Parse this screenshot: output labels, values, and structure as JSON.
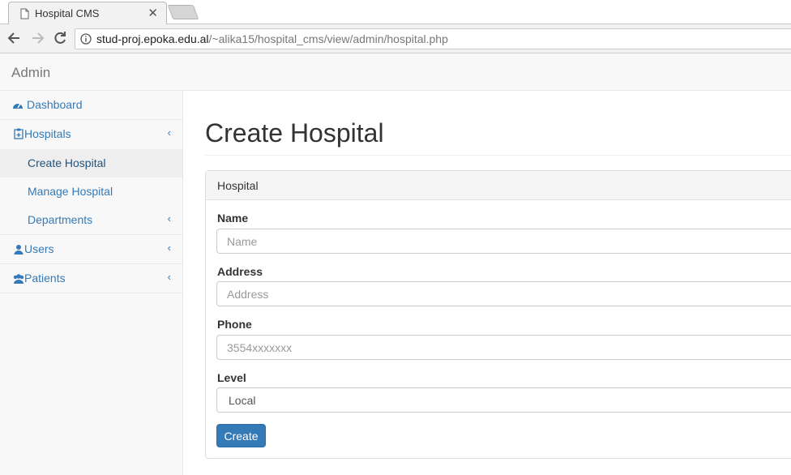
{
  "browser": {
    "tab_title": "Hospital CMS",
    "url_host": "stud-proj.epoka.edu.al",
    "url_path": "/~alika15/hospital_cms/view/admin/hospital.php"
  },
  "navbar": {
    "brand": "Admin"
  },
  "sidebar": {
    "items": [
      {
        "label": "Dashboard",
        "icon": "dashboard-icon"
      },
      {
        "label": "Hospitals",
        "icon": "hospital-icon",
        "arrow": "‹"
      },
      {
        "label": "Users",
        "icon": "user-icon",
        "arrow": "‹"
      },
      {
        "label": "Patients",
        "icon": "users-icon",
        "arrow": "‹"
      }
    ],
    "hospital_subitems": [
      {
        "label": "Create Hospital",
        "active": true
      },
      {
        "label": "Manage Hospital"
      },
      {
        "label": "Departments",
        "arrow": "‹"
      }
    ]
  },
  "main": {
    "title": "Create Hospital",
    "panel_heading": "Hospital",
    "fields": {
      "name": {
        "label": "Name",
        "placeholder": "Name"
      },
      "address": {
        "label": "Address",
        "placeholder": "Address"
      },
      "phone": {
        "label": "Phone",
        "placeholder": "3554xxxxxxx"
      },
      "level": {
        "label": "Level",
        "value": "Local"
      }
    },
    "submit_label": "Create"
  },
  "colors": {
    "link": "#337ab7",
    "primary_button": "#337ab7"
  }
}
